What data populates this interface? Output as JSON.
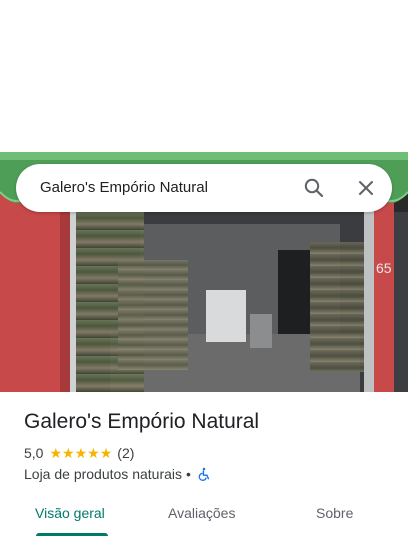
{
  "search": {
    "query": "Galero's Empório Natural"
  },
  "place": {
    "name": "Galero's Empório Natural",
    "rating": "5,0",
    "stars": 5,
    "review_count": "(2)",
    "category": "Loja de produtos naturais",
    "separator": "•"
  },
  "photo": {
    "shop_number": "65"
  },
  "tabs": [
    {
      "label": "Visão geral",
      "active": true
    },
    {
      "label": "Avaliações",
      "active": false
    },
    {
      "label": "Sobre",
      "active": false
    }
  ],
  "colors": {
    "accent": "#00796b",
    "star": "#f5b400",
    "awning_green": "#4caf50",
    "wall_red": "#c8494a"
  },
  "icons": {
    "search": "search-icon",
    "close": "close-icon",
    "star": "star-icon",
    "accessibility": "wheelchair-icon"
  }
}
